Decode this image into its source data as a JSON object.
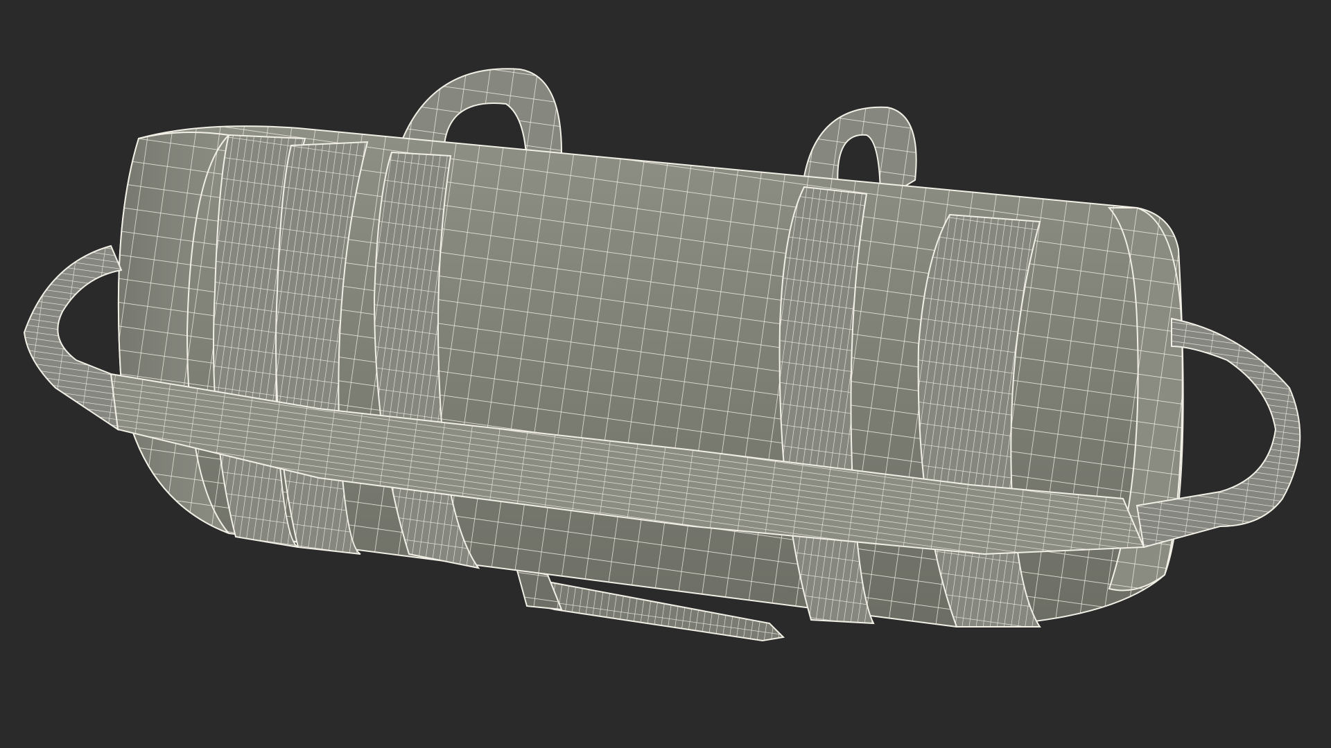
{
  "scene": {
    "background_color": "#2a2a2a",
    "mesh_fill_color": "#82847a",
    "mesh_fill_dark": "#6f7168",
    "mesh_fill_light": "#93958b",
    "wire_color": "#f2f0e6"
  },
  "object": {
    "name": "sandbag-wireframe",
    "parts": [
      "main-cylinder",
      "left-end-cap",
      "right-end-cap",
      "left-end-handle",
      "right-end-handle",
      "top-handle-left",
      "top-handle-right",
      "bottom-handle",
      "horizontal-strap",
      "band-strap-1",
      "band-strap-2",
      "band-strap-3",
      "band-strap-4"
    ]
  }
}
